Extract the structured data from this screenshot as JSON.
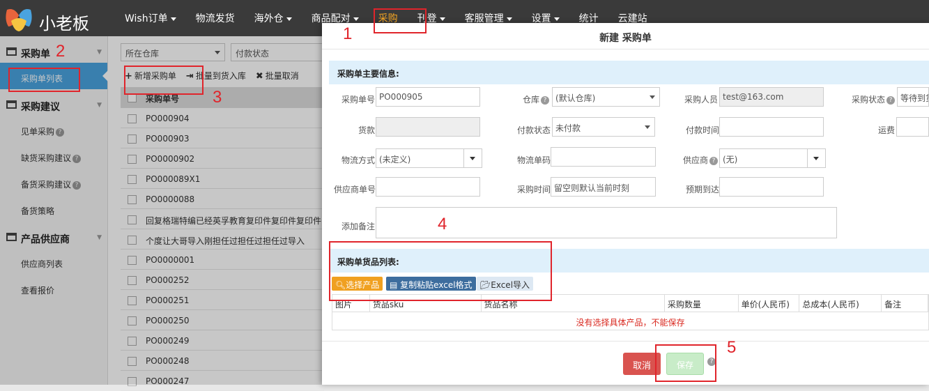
{
  "app": {
    "logo_text": "小老板"
  },
  "nav": [
    "Wish订单",
    "物流发货",
    "海外仓",
    "商品配对",
    "采购",
    "刊登",
    "客服管理",
    "设置",
    "统计",
    "云建站"
  ],
  "nav_dropdown": [
    true,
    false,
    true,
    true,
    false,
    true,
    true,
    true,
    false,
    false
  ],
  "nav_active": 4,
  "sidebar": {
    "g1": "采购单",
    "i1": "采购单列表",
    "g2": "采购建议",
    "i2": "见单采购",
    "i3": "缺货采购建议",
    "i4": "备货采购建议",
    "i5": "备货策略",
    "g3": "产品供应商",
    "i6": "供应商列表",
    "i7": "查看报价"
  },
  "list": {
    "filter_warehouse": "所在仓库",
    "filter_pay": "付款状态",
    "tb_new": "新增采购单",
    "tb_batch": "批量到货入库",
    "tb_cancel": "批量取消",
    "col_no": "采购单号",
    "rows": [
      "PO000904",
      "PO000903",
      "PO0000902",
      "PO000089X1",
      "PO0000088",
      "回复格瑞特编已经英孚教育复印件复印件复印件",
      "个度让大哥导入刚担任过担任过担任过导入",
      "PO0000001",
      "PO000252",
      "PO000251",
      "PO000250",
      "PO000249",
      "PO000248",
      "PO000247"
    ]
  },
  "modal": {
    "title": "新建 采购单",
    "main_section": "采购单主要信息:",
    "lbl_no": "采购单号",
    "val_no": "PO000905",
    "lbl_wh": "仓库",
    "val_wh": "(默认仓库)",
    "lbl_buyer": "采购人员",
    "val_buyer": "test@163.com",
    "lbl_status": "采购状态",
    "val_status": "等待到货",
    "lbl_amount": "货款",
    "lbl_paystatus": "付款状态",
    "val_paystatus": "未付款",
    "lbl_paytime": "付款时间",
    "lbl_freight": "运费",
    "lbl_ship": "物流方式",
    "val_ship": "(未定义)",
    "lbl_track": "物流单码",
    "lbl_supplier": "供应商",
    "val_supplier": "(无)",
    "lbl_supno": "供应商单号",
    "lbl_ptime": "采购时间",
    "val_ptime": "留空则默认当前时刻",
    "lbl_eta": "预期到达",
    "lbl_note": "添加备注",
    "items_section": "采购单货品列表:",
    "btn_select": "选择产品",
    "btn_paste": "复制粘贴excel格式",
    "btn_import": "Excel导入",
    "cols": [
      "图片",
      "货品sku",
      "货品名称",
      "采购数量",
      "单价(人民币)",
      "总成本(人民币)",
      "备注"
    ],
    "empty_msg": "没有选择具体产品，不能保存",
    "cancel": "取消",
    "save": "保存"
  },
  "annotations": [
    "1",
    "2",
    "3",
    "4",
    "5"
  ],
  "colors": {
    "accent": "#f5a623",
    "sidebar_selected": "#4aa3df",
    "highlight": "#e0242b",
    "cancel": "#d9534f"
  }
}
